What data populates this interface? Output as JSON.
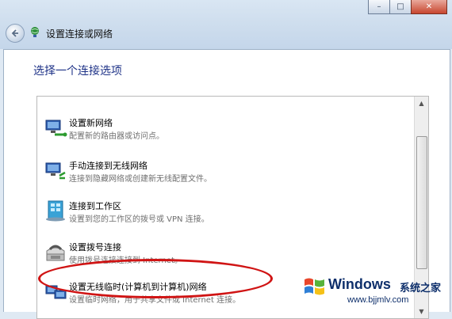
{
  "window": {
    "title": "设置连接或网络",
    "buttons": {
      "minimize": "–",
      "maximize": "□",
      "close": "✕"
    }
  },
  "main": {
    "heading": "选择一个连接选项"
  },
  "options": [
    {
      "title": "设置新网络",
      "desc": "配置新的路由器或访问点。",
      "icon": "network-icon"
    },
    {
      "title": "手动连接到无线网络",
      "desc": "连接到隐藏网络或创建新无线配置文件。",
      "icon": "wireless-network-icon"
    },
    {
      "title": "连接到工作区",
      "desc": "设置到您的工作区的拨号或 VPN 连接。",
      "icon": "workplace-icon"
    },
    {
      "title": "设置拨号连接",
      "desc": "使用拨号连接连接到 Internet。",
      "icon": "dialup-phone-icon"
    },
    {
      "title": "设置无线临时(计算机到计算机)网络",
      "desc": "设置临时网络，用于共享文件或 Internet 连接。",
      "icon": "adhoc-network-icon"
    }
  ],
  "scrollbar": {
    "up": "▲",
    "down": "▼"
  },
  "watermark": {
    "brand": "Windows",
    "site_cn": "系统之家",
    "url": "www.bjjmlv.com"
  },
  "colors": {
    "heading": "#1e3287",
    "highlight_oval": "#d01414"
  }
}
